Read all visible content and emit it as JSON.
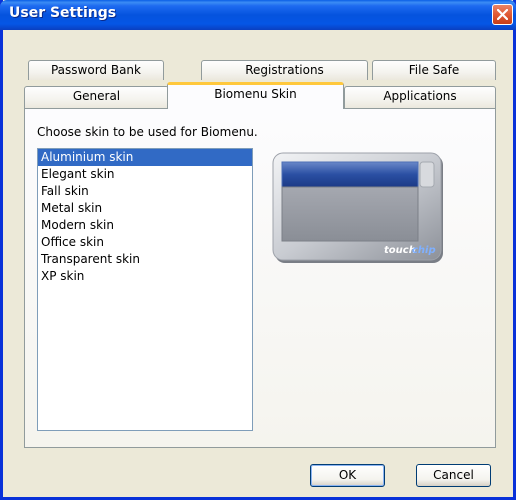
{
  "window": {
    "title": "User Settings"
  },
  "tabs": {
    "row1": [
      {
        "label": "Password Bank"
      },
      {
        "label": "Registrations"
      },
      {
        "label": "File Safe"
      }
    ],
    "row2": [
      {
        "label": "General"
      },
      {
        "label": "Biomenu Skin",
        "active": true
      },
      {
        "label": "Applications"
      }
    ]
  },
  "panel": {
    "caption": "Choose skin to be used for Biomenu.",
    "skins": [
      "Aluminium skin",
      "Elegant skin",
      "Fall skin",
      "Metal skin",
      "Modern skin",
      "Office skin",
      "Transparent skin",
      "XP skin"
    ],
    "selected_skin": "Aluminium skin",
    "preview_brand_left": "touch",
    "preview_brand_right": "chip"
  },
  "buttons": {
    "ok": "OK",
    "cancel": "Cancel"
  },
  "colors": {
    "title_bar": "#0553de",
    "selection": "#316ac5",
    "active_tab_accent": "#ffc83c",
    "close_button": "#e05a35"
  }
}
